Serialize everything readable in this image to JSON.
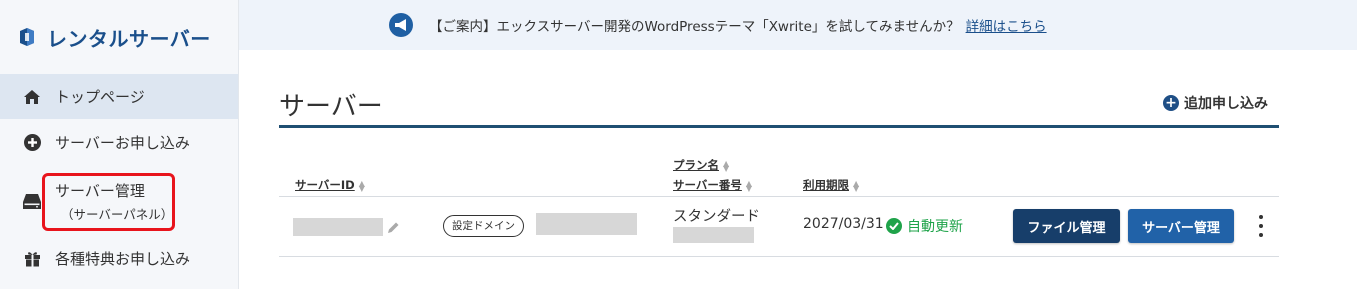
{
  "sidebar": {
    "brand": "レンタルサーバー",
    "items": [
      {
        "label": "トップページ",
        "icon": "home-icon"
      },
      {
        "label": "サーバーお申し込み",
        "icon": "plus-circle-icon"
      },
      {
        "label": "サーバー管理",
        "sub": "（サーバーパネル）",
        "icon": "server-icon"
      },
      {
        "label": "各種特典お申し込み",
        "icon": "gift-icon"
      }
    ]
  },
  "banner": {
    "text": "【ご案内】エックスサーバー開発のWordPressテーマ「Xwrite」を試してみませんか？",
    "link": "詳細はこちら",
    "icon": "megaphone-icon"
  },
  "main": {
    "title": "サーバー",
    "add_label": "追加申し込み",
    "table": {
      "headers": {
        "server_id": "サーバーID",
        "plan_name": "プラン名",
        "server_number": "サーバー番号",
        "expiry": "利用期限"
      },
      "row": {
        "domain_badge": "設定ドメイン",
        "plan": "スタンダード",
        "expiry_date": "2027/03/31",
        "auto_renew": "自動更新",
        "file_button": "ファイル管理",
        "server_button": "サーバー管理"
      }
    }
  },
  "colors": {
    "brand": "#1a4f8b",
    "highlight": "#e8141c",
    "success": "#1fa34a",
    "button_dark": "#173e6a",
    "button_primary": "#2162a8"
  }
}
